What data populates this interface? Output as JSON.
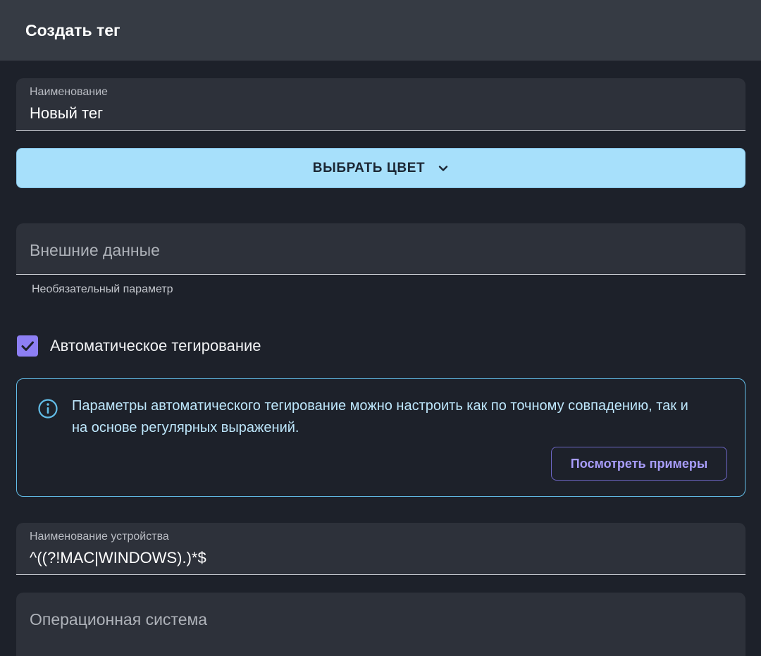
{
  "header": {
    "title": "Создать тег"
  },
  "name_field": {
    "label": "Наименование",
    "value": "Новый тег"
  },
  "color_button": {
    "label": "ВЫБРАТЬ ЦВЕТ",
    "icon": "chevron-down-icon"
  },
  "external_field": {
    "placeholder": "Внешние данные",
    "helper": "Необязательный параметр"
  },
  "auto_tagging": {
    "label": "Автоматическое тегирование",
    "checked": true
  },
  "info": {
    "icon": "info-icon",
    "text": "Параметры автоматического тегирование можно настроить как по точному совпадению, так и на основе регулярных выражений.",
    "button_label": "Посмотреть примеры"
  },
  "device_field": {
    "label": "Наименование устройства",
    "value": "^((?!MAC|WINDOWS).)*$"
  },
  "os_field": {
    "placeholder": "Операционная система"
  },
  "colors": {
    "background": "#1d212a",
    "header": "#363b44",
    "field": "#2d313a",
    "color_button": "#a7e0fb",
    "checkbox": "#8d7ff4",
    "info_border": "#62bde8",
    "info_text": "#bde6fb",
    "examples_button": "#a89dfa"
  }
}
